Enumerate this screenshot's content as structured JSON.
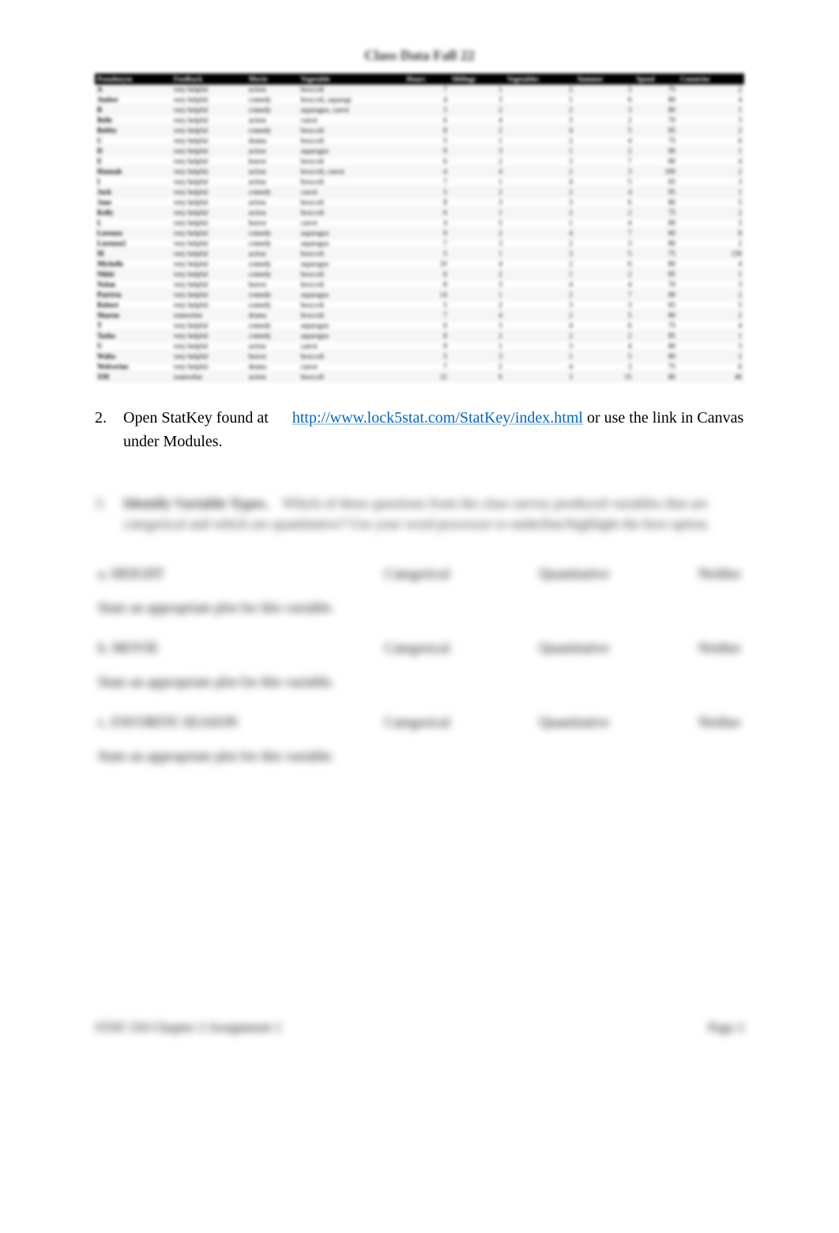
{
  "title": "Class Data Fall 22",
  "table": {
    "headers": [
      "Pseudonym",
      "Feedback",
      "Movie",
      "Vegetable",
      "Hours",
      "Siblings",
      "Vegetables",
      "Summer",
      "Speed",
      "Countries"
    ],
    "rows": [
      [
        "A",
        "very helpful",
        "action",
        "broccoli",
        "7",
        "1",
        "2",
        "3",
        "75",
        "2"
      ],
      [
        "Amber",
        "very helpful",
        "comedy",
        "broccoli, asparagi",
        "4",
        "3",
        "1",
        "6",
        "80",
        "4"
      ],
      [
        "B",
        "very helpful",
        "comedy",
        "asparagus, carrot",
        "3",
        "2",
        "2",
        "3",
        "80",
        "1"
      ],
      [
        "Belle",
        "very helpful",
        "action",
        "carrot",
        "6",
        "4",
        "3",
        "2",
        "70",
        "3"
      ],
      [
        "Bobby",
        "very helpful",
        "comedy",
        "broccoli",
        "8",
        "2",
        "4",
        "5",
        "85",
        "2"
      ],
      [
        "C",
        "very helpful",
        "drama",
        "broccoli",
        "5",
        "1",
        "2",
        "4",
        "75",
        "6"
      ],
      [
        "D",
        "very helpful",
        "action",
        "asparagus",
        "9",
        "3",
        "1",
        "2",
        "90",
        "1"
      ],
      [
        "E",
        "very helpful",
        "horror",
        "broccoli",
        "6",
        "2",
        "3",
        "7",
        "80",
        "4"
      ],
      [
        "Hannah",
        "very helpful",
        "action",
        "broccoli, carrot",
        "4",
        "4",
        "2",
        "3",
        "100",
        "2"
      ],
      [
        "I",
        "very helpful",
        "action",
        "broccoli",
        "7",
        "1",
        "4",
        "5",
        "65",
        "3"
      ],
      [
        "Jack",
        "very helpful",
        "comedy",
        "carrot",
        "5",
        "2",
        "2",
        "4",
        "95",
        "1"
      ],
      [
        "Jane",
        "very helpful",
        "action",
        "broccoli",
        "8",
        "3",
        "3",
        "6",
        "80",
        "5"
      ],
      [
        "Kelly",
        "very helpful",
        "action",
        "broccoli",
        "6",
        "1",
        "2",
        "2",
        "75",
        "2"
      ],
      [
        "L",
        "very helpful",
        "horror",
        "carrot",
        "4",
        "5",
        "1",
        "4",
        "80",
        "3"
      ],
      [
        "Lorenzo",
        "very helpful",
        "comedy",
        "asparagus",
        "9",
        "2",
        "4",
        "7",
        "60",
        "8"
      ],
      [
        "Lorenzo2",
        "very helpful",
        "comedy",
        "asparagus",
        "7",
        "3",
        "2",
        "3",
        "80",
        "2"
      ],
      [
        "M",
        "very helpful",
        "action",
        "broccoli",
        "5",
        "1",
        "3",
        "5",
        "75",
        "130"
      ],
      [
        "Michelle",
        "very helpful",
        "comedy",
        "asparagus",
        "10",
        "4",
        "2",
        "6",
        "80",
        "4"
      ],
      [
        "Nikki",
        "very helpful",
        "comedy",
        "broccoli",
        "6",
        "2",
        "1",
        "2",
        "85",
        "1"
      ],
      [
        "Nolan",
        "very helpful",
        "horror",
        "broccoli",
        "8",
        "3",
        "4",
        "4",
        "70",
        "3"
      ],
      [
        "Patricia",
        "very helpful",
        "comedy",
        "asparagus",
        "14",
        "1",
        "2",
        "7",
        "80",
        "2"
      ],
      [
        "Robert",
        "very helpful",
        "comedy",
        "broccoli",
        "5",
        "2",
        "3",
        "3",
        "65",
        "5"
      ],
      [
        "Sharon",
        "somewhat",
        "drama",
        "broccoli",
        "7",
        "4",
        "2",
        "5",
        "80",
        "2"
      ],
      [
        "T",
        "very helpful",
        "comedy",
        "asparagus",
        "6",
        "3",
        "4",
        "6",
        "75",
        "4"
      ],
      [
        "Tasha",
        "very helpful",
        "comedy",
        "asparagus",
        "8",
        "2",
        "2",
        "2",
        "85",
        "1"
      ],
      [
        "U",
        "very helpful",
        "action",
        "carrot",
        "9",
        "1",
        "3",
        "4",
        "80",
        "3"
      ],
      [
        "Walta",
        "very helpful",
        "horror",
        "broccoli",
        "5",
        "3",
        "1",
        "5",
        "80",
        "2"
      ],
      [
        "Wolverine",
        "very helpful",
        "drama",
        "carrot",
        "7",
        "2",
        "4",
        "3",
        "75",
        "6"
      ],
      [
        "XM",
        "somewhat",
        "action",
        "broccoli",
        "12",
        "6",
        "3",
        "15",
        "80",
        "46"
      ]
    ]
  },
  "step2": {
    "num": "2.",
    "before": "Open StatKey found at",
    "link_text": "http://www.lock5stat.com/StatKey/index.html",
    "link_href": "http://www.lock5stat.com/StatKey/index.html",
    "after": " or use the link in Canvas under Modules."
  },
  "step3": {
    "num": "3.",
    "bold": "Identify Variable Types.",
    "text": "Which of these questions from the class survey produced variables that are categorical and which are quantitative? Use your word processor to underline/highlight the best option."
  },
  "variables": [
    {
      "id": "a.",
      "name": "HEIGHT",
      "opt1": "Categorical",
      "opt2": "Quantitative",
      "opt3": "Neither"
    },
    {
      "id": "b.",
      "name": "MOVIE",
      "opt1": "Categorical",
      "opt2": "Quantitative",
      "opt3": "Neither"
    },
    {
      "id": "c.",
      "name": "FAVORITE SEASON",
      "opt1": "Categorical",
      "opt2": "Quantitative",
      "opt3": "Neither"
    }
  ],
  "prompt": "State an appropriate plot for this variable.",
  "footer": {
    "left": "STAT 250 Chapter 2 Assignment 1",
    "right": "Page 2"
  }
}
